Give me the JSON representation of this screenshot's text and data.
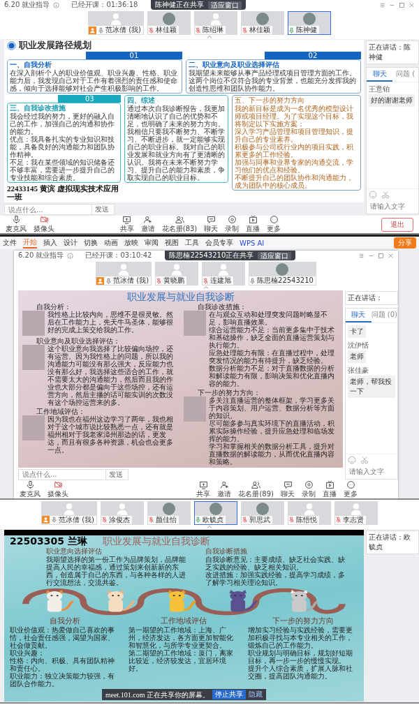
{
  "meetings": [
    {
      "header": {
        "title": "6.20 就业指导",
        "elapsed": "已经开课：01:36:18"
      },
      "share_banner": {
        "text": "陈神健正在共享",
        "button": "适应窗口"
      },
      "participants": [
        {
          "name": "范冰倩 (我)",
          "host": true,
          "muted": false,
          "kind": "silhouette",
          "selected": false
        },
        {
          "name": "林佳颖",
          "host": false,
          "muted": true,
          "kind": "photo",
          "selected": false
        },
        {
          "name": "陈绍琳",
          "host": false,
          "muted": true,
          "kind": "silhouette",
          "selected": false
        },
        {
          "name": "林佳颖",
          "host": false,
          "muted": true,
          "kind": "photo",
          "selected": false
        },
        {
          "name": "陈神健",
          "host": false,
          "muted": false,
          "kind": "photo",
          "selected": true
        }
      ],
      "slide": {
        "kind": "cards",
        "title": "职业发展路径规划",
        "cards": [
          {
            "kind": "blue",
            "number": "01",
            "heading": "一、自我分析",
            "paragraphs": [
              "在深入剖析个人的职业价值观、职业兴趣、性格、职业能力后，我发现自己对于工作有着强烈的责任感和使命感，倾向于选择能够对社会产生积极影响的工作。"
            ]
          },
          {
            "kind": "blue",
            "number": "02",
            "heading": "二、职业意向及职业选择评估",
            "paragraphs": [
              "我期望未来能够从事产品经理或项目管理方面的工作。这两个岗位不仅符合我的专业背景，也能充分发挥我的创造性思维和团队协作能力。"
            ]
          },
          {
            "kind": "teal",
            "number": "03",
            "heading": "三、自我诊改措施",
            "paragraphs": [
              "我会经过我的努力，更好的融入自己的工作，加强自己的沟通和协作的能力。",
              "优点：我具备扎实的专业知识和技能，具备良好的沟通能力和团队协作精神。",
              "不足：我在某些领域的知识储备还不够丰富，需要进一步提升自己的专业技能和综合素质。"
            ]
          },
          {
            "kind": "teal",
            "heading": "四、综述",
            "paragraphs": [
              "通过本次自我诊断报告，我更加清晰地认识了自己的优势和不足，也明确了未来的努力方向。我相信只要我不断努力、不断学习、不断进步，就一定能够实现自己的职业目标。我对自己的职业发展和就业方向有了更清晰的认识。我将在未来不断努力学习、提升自己的能力和素质，争取实现自己的职业目标。"
            ]
          },
          {
            "kind": "brown",
            "heading": "五、下一步的努力方向",
            "paragraphs": [
              "我的新目标是成为一名优秀的模型设计师或项目经理。为了实现这个目标，我将制定以下实施方案：",
              "深入学习产品管理和项目管理知识，提升自己的专业素养。",
              "积极参与公司或行业内的项目实践，积累更多的工作经验。",
              "加强与同事和业界专家的沟通交流，学习他们的优点和经验。",
              "不断提升自己的团队协作和沟通能力，成为团队中的核心成员。"
            ]
          }
        ],
        "caption": "22433145 黄滨 虚拟现实技术应用一班"
      },
      "chat_input": {
        "placeholder": "说点什么...",
        "button": "发送"
      },
      "side": {
        "speaking": "正在讲话：陈神健",
        "chat": {
          "tabs": [
            {
              "label": "聊天",
              "selected": true
            },
            {
              "label": "问题 (",
              "selected": false
            }
          ],
          "messages": [
            {
              "sender": "王意铂",
              "text": "好的谢谢老师"
            }
          ],
          "placeholder": "请输入文字"
        }
      },
      "toolbar": {
        "items": [
          {
            "label": "麦克风",
            "off": false
          },
          {
            "label": "摄像头",
            "off": true
          },
          {
            "label": "共享",
            "off": false
          },
          {
            "label": "邀请",
            "off": false
          },
          {
            "label": "花名册(83)",
            "off": false
          },
          {
            "label": "聊天",
            "off": false
          },
          {
            "label": "录制",
            "off": false
          },
          {
            "label": "直播",
            "off": false
          },
          {
            "label": "更多",
            "off": false
          }
        ],
        "exit": "退出"
      }
    },
    {
      "ribbon": {
        "file": "文件",
        "tabs": [
          {
            "label": "开始",
            "selected": true
          },
          {
            "label": "插入",
            "selected": false
          },
          {
            "label": "设计",
            "selected": false
          },
          {
            "label": "切换",
            "selected": false
          },
          {
            "label": "动画",
            "selected": false
          },
          {
            "label": "放映",
            "selected": false
          },
          {
            "label": "审阅",
            "selected": false
          },
          {
            "label": "视图",
            "selected": false
          },
          {
            "label": "工具",
            "selected": false
          },
          {
            "label": "会员专享",
            "selected": false
          }
        ],
        "ai": "WPS AI",
        "share": "分享"
      },
      "header": {
        "title": "6.20 就业指导",
        "elapsed": "已经开课：03:10:42"
      },
      "share_banner": {
        "text": "陈思楠22543210正在共享",
        "button": "适应窗口"
      },
      "participants": [
        {
          "name": "范冰倩 (我)",
          "host": true,
          "muted": false,
          "kind": "silhouette",
          "selected": false
        },
        {
          "name": "黄晓鹏",
          "host": false,
          "muted": true,
          "kind": "silhouette",
          "selected": false
        },
        {
          "name": "连建旭",
          "host": false,
          "muted": true,
          "kind": "silhouette",
          "selected": false
        },
        {
          "name": "陈思楠22543210",
          "host": false,
          "muted": false,
          "kind": "photo",
          "selected": false
        }
      ],
      "slide": {
        "kind": "collage",
        "title": "职业发展与就业自我诊断",
        "left": [
          {
            "heading": "自我分析：",
            "paragraphs": [
              "我性格上比较内向，思维不是很灵敏。然后在工作能力上，先天牛马圣体，能够很好的完成上策交给我的工作。"
            ]
          },
          {
            "heading": "职业意向及职业选择评估：",
            "paragraphs": [
              "这个职业意向我选择了比较偏向场控，还有运营。因为我性格上的问题，所以我的沟通能力可能没有那么强大，反应能力也没有那么好，我选择这些适合的工作，就不需要太大的沟通能力，然后而且我的作业也大部分都是偏向于这些场控，还有运营方向，然后主播的话可能实训的次数没有这个场控运营来的多。"
            ]
          },
          {
            "heading": "工作地域评估：",
            "paragraphs": [
              "因为我也在福州这边学习了两年，我也相对于这个城市说比较熟悉一点，还有就是福州相对于我老家漳州那边的话，更发达，而且有很多各种资源，机会也会更多一点。"
            ]
          }
        ],
        "right": [
          {
            "heading": "自我诊改措施：",
            "paragraphs": [
              "在与观众互动和处理突发问题时略显不足，影响直播效果。",
              "综合运营能力不足：当前更多集中于技术和基础操作，缺乏全面的直播运营策划与执行能力。",
              "应急处理能力有限：在直播过程中，处理突发情况的能力有待提升，缺乏经验。",
              "数据分析能力不足：对于直播数据的分析和解读能力有限，影响决策和优化直播内容的能力。"
            ]
          },
          {
            "heading": "下一步的努力方向：",
            "paragraphs": [
              "多关注直播运营的整体框架，学习更多关于内容策划、用户运营、数据分析等方面的知识。",
              "尽可能多参与真实环境下的直播活动，积累实际操作经验，提升应急处理和临场发挥的能力。",
              "学习和掌握相关的数据分析工具，提升对直播数据的解读能力，从而优化直播内容和策略。"
            ]
          }
        ]
      },
      "chat_input": {
        "placeholder": "说点什么...",
        "button": "发送"
      },
      "side": {
        "speaking": "正在讲话：",
        "chat": {
          "tabs": [
            {
              "label": "聊天",
              "selected": true
            },
            {
              "label": "问题 (0)",
              "selected": false
            }
          ],
          "messages": [
            {
              "text": "卡了"
            },
            {
              "sender": "沈伊恬",
              "text": "老师"
            },
            {
              "sender": "张佳豪",
              "text": "老师，帮我投一下"
            }
          ],
          "placeholder": "请输入文字"
        }
      },
      "toolbar": {
        "items": [
          {
            "label": "麦克风",
            "off": false
          },
          {
            "label": "摄像头",
            "off": true
          },
          {
            "label": "共享",
            "off": false
          },
          {
            "label": "邀请",
            "off": false
          },
          {
            "label": "花名册(89)",
            "off": false
          },
          {
            "label": "聊天",
            "off": false
          },
          {
            "label": "录制",
            "off": false
          },
          {
            "label": "直播",
            "off": false
          },
          {
            "label": "更多",
            "off": false
          }
        ]
      }
    },
    {
      "participants": [
        {
          "name": "范冰倩 (我)",
          "host": true,
          "muted": false,
          "kind": "silhouette",
          "selected": false
        },
        {
          "name": "涂俊杰",
          "host": false,
          "muted": true,
          "kind": "silhouette",
          "selected": false
        },
        {
          "name": "颜佳怡",
          "host": false,
          "muted": true,
          "kind": "photo",
          "selected": false
        },
        {
          "name": "欧毓贞",
          "host": false,
          "muted": false,
          "kind": "photo",
          "selected": true
        },
        {
          "name": "郭思武",
          "host": false,
          "muted": true,
          "kind": "photo",
          "selected": false
        },
        {
          "name": "陈悟悦",
          "host": false,
          "muted": true,
          "kind": "silhouette",
          "selected": false
        },
        {
          "name": "李志贤",
          "host": false,
          "muted": true,
          "kind": "silhouette",
          "selected": false
        }
      ],
      "slide": {
        "kind": "cats",
        "badge": "22503305 兰琳",
        "title": "职业发展与就业自我诊断",
        "top": [
          {
            "heading": "职业意向选择评估",
            "paragraphs": [
              "我期望选择的第一份工作为品牌策划，品牌能提高人民的幸福感，通过策划来创新新的东西，创造属于自己的东西，与各种各样的人进行交流想法，交流共鉴。"
            ]
          },
          {
            "heading": "自我诊断措施",
            "paragraphs": [
              "自我诊断意见：主要成绩、缺乏社会实践、缺乏实践的经验、缺乏相关知识。",
              "改进措施：加强实践经验，提高学习成绩，多了解学习相关理论知识。"
            ]
          }
        ],
        "bottom": [
          {
            "heading": "自我分析",
            "paragraphs": [
              "职业价值观：热爱做自己喜欢的事情，社会责任感强，渴望为国家、社会做贡献。",
              "职业兴趣：",
              "性格：内向、积极、具有团队精神和责任心。",
              "职业能力：独立决策能力较强，有团队合作能力。"
            ]
          },
          {
            "heading": "工作地域评估",
            "paragraphs": [
              "第一期望的工作地域：上海、广州，经济发达，各方面更加智能化和智慧化，与所学专业更契合。",
              "第二期望的工作地域：厦门，离家比较近，经济较发达，宜居环境好。"
            ]
          },
          {
            "heading": "下一步的努力方向",
            "paragraphs": [
              "增加实习经验与实践经验，需要更加积极寻找与本专业相关的工作，锻炼自己的工作能力。",
              "职业规划与明确目标，规划好短期目标，再一步一步的慢慢实现。",
              "提升个人综合素质，扩展人脉和社交圈，提高团队沟通能力。"
            ]
          }
        ],
        "share_notice": {
          "text": "meet.101.com 正在共享你的屏幕。",
          "stop": "停止共享",
          "hide": "隐藏"
        }
      },
      "side": {
        "speaking": "正在讲话：欧毓贞"
      }
    }
  ]
}
